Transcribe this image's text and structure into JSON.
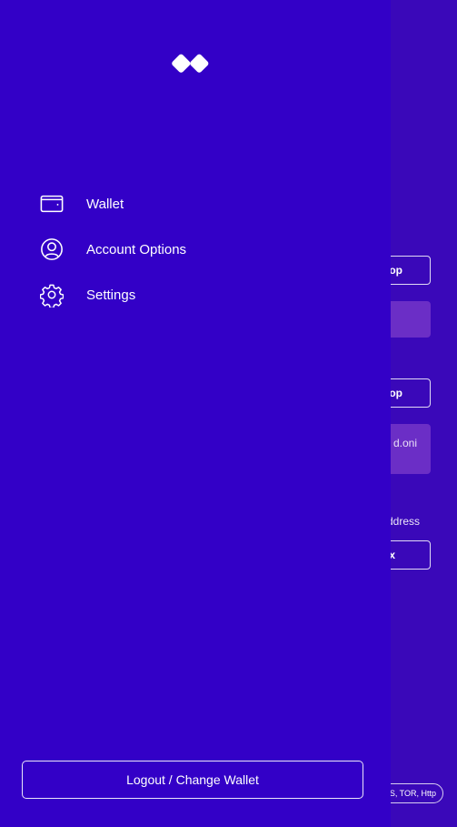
{
  "drawer": {
    "logo_icon": "diamond-pair-logo",
    "items": [
      {
        "label": "Wallet",
        "icon": "wallet-icon"
      },
      {
        "label": "Account Options",
        "icon": "account-icon"
      },
      {
        "label": "Settings",
        "icon": "gear-icon"
      }
    ],
    "logout_label": "Logout / Change Wallet"
  },
  "background": {
    "button_1_label": "top",
    "button_2_label": "top",
    "box_text": "d.oni",
    "address_label": "ddress",
    "button_3_label": "x",
    "network_pill": "QS, TOR, Http"
  },
  "colors": {
    "drawer_bg": "#3300c7",
    "background_bg": "#3a08b9",
    "input_box": "#6b2ec6",
    "text": "#ffffff"
  }
}
